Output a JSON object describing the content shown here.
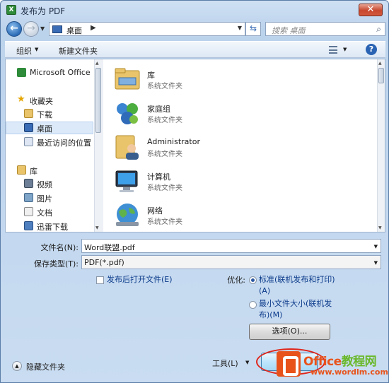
{
  "window": {
    "title": "发布为 PDF",
    "close_label": "✕",
    "app_icon_letter": "X"
  },
  "nav": {
    "back": "←",
    "forward": "→",
    "address_location": "桌面",
    "search_placeholder": "搜索 桌面"
  },
  "toolbar": {
    "organize": "组织",
    "new_folder": "新建文件夹",
    "help": "?"
  },
  "sidebar": {
    "items": [
      {
        "label": "Microsoft Office",
        "icon": "office-icon"
      },
      {
        "label": "收藏夹",
        "icon": "star-icon"
      },
      {
        "label": "下载",
        "icon": "download-folder-icon"
      },
      {
        "label": "桌面",
        "icon": "desktop-icon",
        "selected": true
      },
      {
        "label": "最近访问的位置",
        "icon": "recent-places-icon"
      },
      {
        "label": "库",
        "icon": "library-icon"
      },
      {
        "label": "视频",
        "icon": "video-icon"
      },
      {
        "label": "图片",
        "icon": "pictures-icon"
      },
      {
        "label": "文档",
        "icon": "documents-icon"
      },
      {
        "label": "迅雷下载",
        "icon": "thunder-download-icon"
      }
    ]
  },
  "files": [
    {
      "name": "库",
      "type": "系统文件夹",
      "icon": "library-folder-icon"
    },
    {
      "name": "家庭组",
      "type": "系统文件夹",
      "icon": "homegroup-icon"
    },
    {
      "name": "Administrator",
      "type": "系统文件夹",
      "icon": "user-folder-icon"
    },
    {
      "name": "计算机",
      "type": "系统文件夹",
      "icon": "computer-icon"
    },
    {
      "name": "网络",
      "type": "系统文件夹",
      "icon": "network-icon"
    }
  ],
  "form": {
    "filename_label": "文件名(N):",
    "filename_value": "Word联盟.pdf",
    "savetype_label": "保存类型(T):",
    "savetype_value": "PDF(*.pdf)",
    "open_after": "发布后打开文件(E)",
    "optimize_label": "优化:",
    "opt_standard_1": "标准(联机发布和打印)",
    "opt_standard_2": "(A)",
    "opt_min_1": "最小文件大小(联机发",
    "opt_min_2": "布)(M)",
    "options_button": "选项(O)..."
  },
  "footer": {
    "hide_folders": "隐藏文件夹",
    "tools": "工具(L)"
  },
  "watermark": {
    "title_a": "Office",
    "title_b": "教程网",
    "url": "www.wordlm.com"
  }
}
